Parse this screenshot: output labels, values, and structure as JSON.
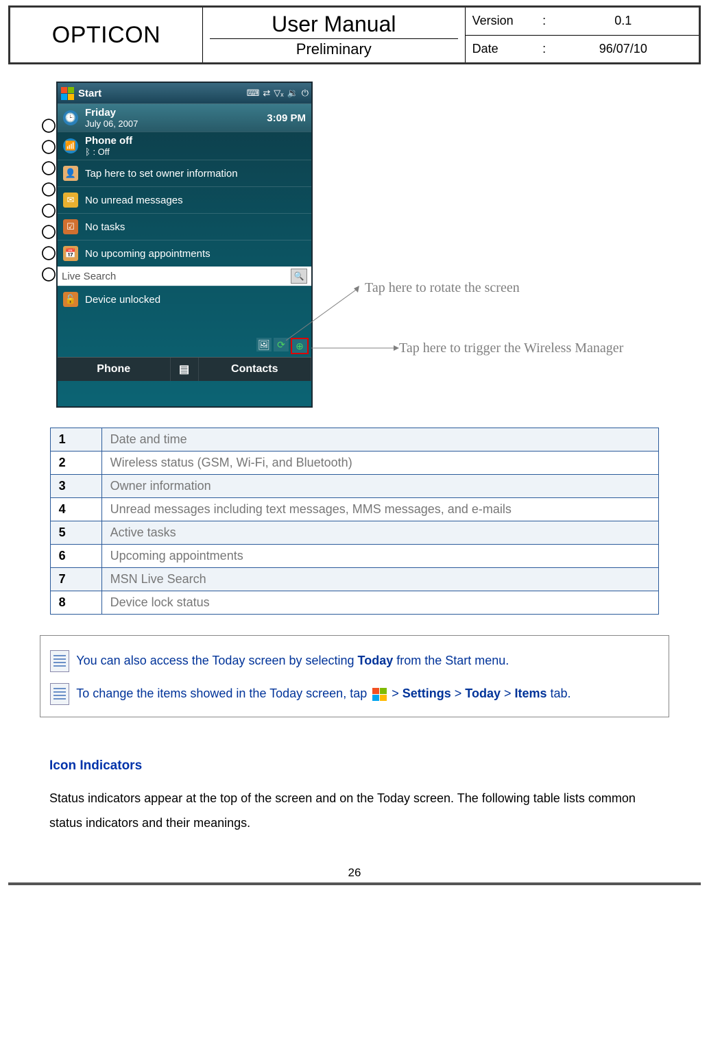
{
  "header": {
    "brand": "OPTICON",
    "title_top": "User Manual",
    "title_bottom": "Preliminary",
    "version_label": "Version",
    "version_value": "0.1",
    "date_label": "Date",
    "date_value": "96/07/10"
  },
  "markers": [
    "〇",
    "〇",
    "〇",
    "〇",
    "〇",
    "〇",
    "〇",
    "〇"
  ],
  "phone": {
    "start": "Start",
    "time": "3:09 PM",
    "day": "Friday",
    "date": "July 06, 2007",
    "phone_off": "Phone off",
    "bt_off": ": Off",
    "owner": "Tap here to set owner information",
    "messages": "No unread messages",
    "tasks": "No tasks",
    "appts": "No upcoming appointments",
    "search_placeholder": "Live Search",
    "device_unlocked": "Device unlocked",
    "soft_left": "Phone",
    "soft_right": "Contacts"
  },
  "callout1": "Tap here to rotate the screen",
  "callout2": "Tap here to trigger the Wireless Manager",
  "legend": [
    {
      "n": "1",
      "d": "Date and time"
    },
    {
      "n": "2",
      "d": "Wireless status (GSM, Wi-Fi, and Bluetooth)"
    },
    {
      "n": "3",
      "d": "Owner information"
    },
    {
      "n": "4",
      "d": "Unread messages including text messages, MMS messages, and e-mails"
    },
    {
      "n": "5",
      "d": "Active tasks"
    },
    {
      "n": "6",
      "d": "Upcoming appointments"
    },
    {
      "n": "7",
      "d": "MSN Live Search"
    },
    {
      "n": "8",
      "d": "Device lock status"
    }
  ],
  "note": {
    "line1a": "You can also access the Today screen by selecting ",
    "line1b": "Today",
    "line1c": " from the Start menu.",
    "line2a": "To change the items showed in the Today screen, tap ",
    "gt": " > ",
    "settings": "Settings",
    "today": "Today",
    "items": "Items",
    "tab": " tab."
  },
  "section_heading": "Icon Indicators",
  "body": "Status indicators appear at the top of the screen and on the Today screen. The following table lists common status indicators and their meanings.",
  "page_number": "26"
}
